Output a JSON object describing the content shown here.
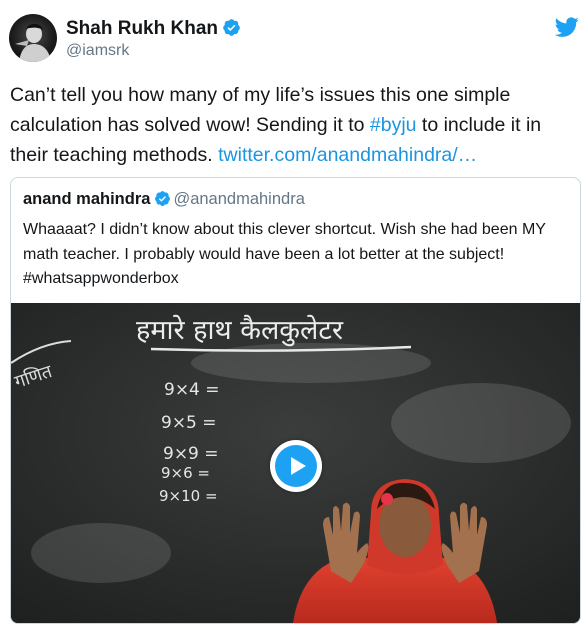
{
  "tweet": {
    "author": {
      "name": "Shah Rukh Khan",
      "handle": "@iamsrk",
      "avatar_icon": "avatar-photo",
      "verified_icon": "verified-badge-icon"
    },
    "logo_icon": "twitter-bird-icon",
    "text": {
      "part1": "Can’t tell you how many of my life’s issues this one simple calculation has solved wow! Sending it to ",
      "hashtag": "#byju",
      "part2": " to include it in their teaching methods. ",
      "link": "twitter.com/anandmahindra/…"
    }
  },
  "quoted": {
    "name": "anand mahindra",
    "handle": "@anandmahindra",
    "text": "Whaaaat? I didn’t know about this clever shortcut. Wish she had been MY math teacher. I probably would have been a lot better at the subject! #whatsappwonderbox",
    "media": {
      "type": "video",
      "play_icon": "play-icon",
      "chalkboard_title": "हमारे हाथ कैलकुलेटर",
      "side_label": "गणित",
      "equations": [
        "9×4 =",
        "9×5 =",
        "9×9 =",
        "9×6 =",
        "9×10 ="
      ]
    }
  },
  "colors": {
    "link": "#1b95e0",
    "verified": "#1da1f2",
    "text": "#14171a",
    "muted": "#657786",
    "border": "#ccd6dd"
  }
}
